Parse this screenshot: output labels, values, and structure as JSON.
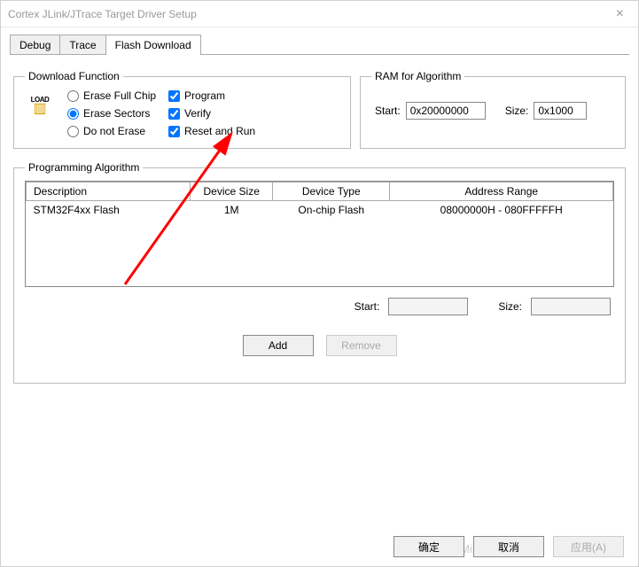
{
  "window": {
    "title": "Cortex JLink/JTrace Target Driver Setup"
  },
  "tabs": {
    "t0": "Debug",
    "t1": "Trace",
    "t2": "Flash Download"
  },
  "download_function": {
    "legend": "Download Function",
    "load_label": "LOAD",
    "radios": {
      "r0": "Erase Full Chip",
      "r1": "Erase Sectors",
      "r2": "Do not Erase"
    },
    "checks": {
      "c0": "Program",
      "c1": "Verify",
      "c2": "Reset and Run"
    }
  },
  "ram": {
    "legend": "RAM for Algorithm",
    "start_label": "Start:",
    "start_value": "0x20000000",
    "size_label": "Size:",
    "size_value": "0x1000"
  },
  "prog": {
    "legend": "Programming Algorithm",
    "headers": {
      "h0": "Description",
      "h1": "Device Size",
      "h2": "Device Type",
      "h3": "Address Range"
    },
    "row": {
      "c0": "STM32F4xx Flash",
      "c1": "1M",
      "c2": "On-chip Flash",
      "c3": "08000000H - 080FFFFFH"
    },
    "start_label": "Start:",
    "start_value": "",
    "size_label": "Size:",
    "size_value": "",
    "add": "Add",
    "remove": "Remove"
  },
  "dialog": {
    "ok": "确定",
    "cancel": "取消",
    "apply": "应用(A)"
  },
  "watermark": "CSDN @Mini_shimmer"
}
